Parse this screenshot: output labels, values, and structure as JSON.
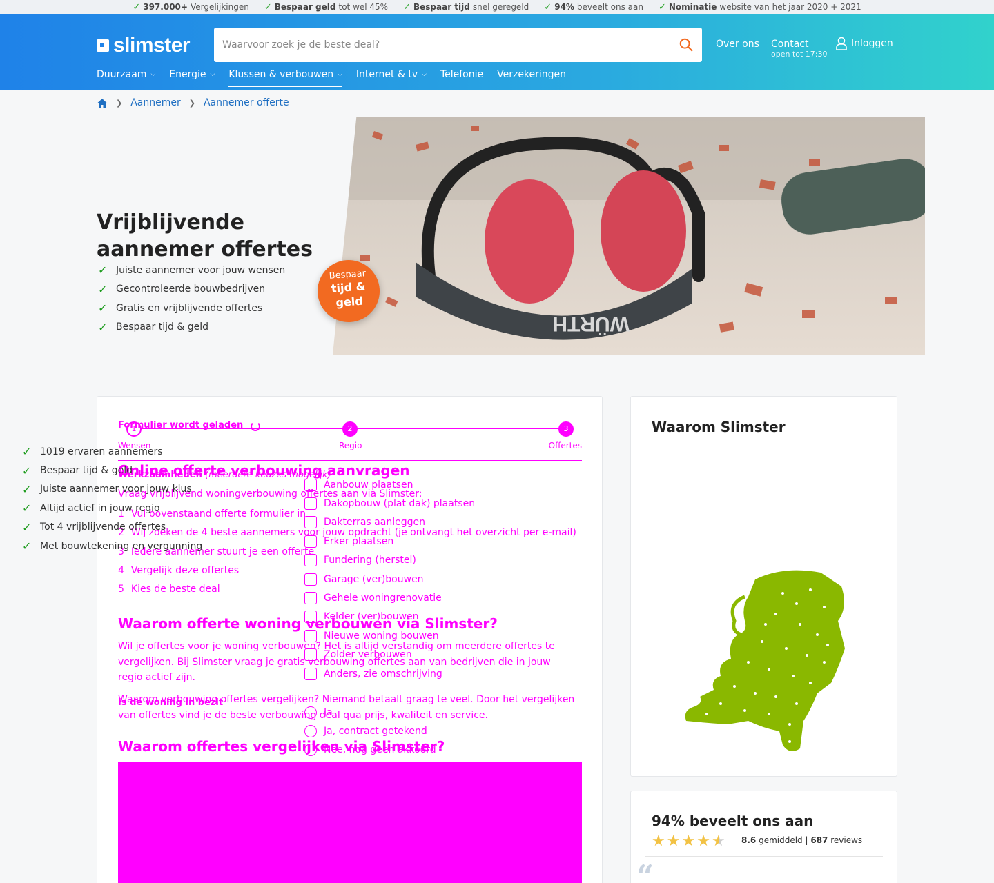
{
  "usp_bar": [
    {
      "bold": "397.000+",
      "text": " Vergelijkingen"
    },
    {
      "bold": "Bespaar geld",
      "text": " tot wel 45%"
    },
    {
      "bold": "Bespaar tijd",
      "text": " snel geregeld"
    },
    {
      "bold": "94%",
      "text": " beveelt ons aan"
    },
    {
      "bold": "Nominatie",
      "text": " website van het jaar 2020 + 2021"
    }
  ],
  "header": {
    "logo": "slimster",
    "search_placeholder": "Waarvoor zoek je de beste deal?",
    "over_ons": "Over ons",
    "contact": "Contact",
    "contact_hours": "open tot 17:30",
    "login": "Inloggen",
    "nav": [
      {
        "label": "Duurzaam",
        "dropdown": true
      },
      {
        "label": "Energie",
        "dropdown": true
      },
      {
        "label": "Klussen & verbouwen",
        "dropdown": true,
        "active": true
      },
      {
        "label": "Internet & tv",
        "dropdown": true
      },
      {
        "label": "Telefonie",
        "dropdown": false
      },
      {
        "label": "Verzekeringen",
        "dropdown": false
      }
    ]
  },
  "breadcrumb": [
    "Aannemer",
    "Aannemer offerte"
  ],
  "hero": {
    "title": "Vrijblijvende aannemer offertes",
    "bullets": [
      "Juiste aannemer voor jouw wensen",
      "Gecontroleerde bouwbedrijven",
      "Gratis en vrijblijvende offertes",
      "Bespaar tijd & geld"
    ],
    "badge_top": "Bespaar",
    "badge_bottom": "tijd & geld"
  },
  "form": {
    "loading": "Formulier wordt geladen",
    "steps": [
      "Wensen",
      "Regio",
      "Offertes"
    ],
    "step_numbers": [
      "1",
      "2",
      "3"
    ],
    "field_werkzaamheden": "Werkzaamheden",
    "field_werkzaamheden_hint": " (meerdere keuzes mogelijk)",
    "options": [
      "Aanbouw plaatsen",
      "Dakopbouw (plat dak) plaatsen",
      "Dakterras aanleggen",
      "Erker plaatsen",
      "Fundering (herstel)",
      "Garage (ver)bouwen",
      "Gehele woningrenovatie",
      "Kelder (ver)bouwen",
      "Nieuwe woning bouwen",
      "Zolder verbouwen",
      "Anders, zie omschrijving"
    ],
    "field_woning": "Is de woning in bezit",
    "woning_options": [
      "Ja",
      "Ja, contract getekend",
      "Nee, nog geen akkoord"
    ]
  },
  "article": {
    "h1": "Online offerte verbouwing aanvragen",
    "intro": "Vraag vrijblijvend woningverbouwing offertes aan via Slimster:",
    "steps": [
      "Vul bovenstaand offerte formulier in",
      "Wij zoeken de 4 beste aannemers voor jouw opdracht (je ontvangt het overzicht per e-mail)",
      "Iedere aannemer stuurt je een offerte",
      "Vergelijk deze offertes",
      "Kies de beste deal"
    ],
    "h2": "Waarom offerte woning verbouwen via Slimster?",
    "p1": "Wil je offertes voor je woning verbouwen? Het is altijd verstandig om meerdere offertes te vergelijken. Bij Slimster vraag je gratis verbouwing offertes aan van bedrijven die in jouw regio actief zijn.",
    "p2": "Waarom verbouwing offertes vergelijken? Niemand betaalt graag te veel. Door het vergelijken van offertes vind je de beste verbouwing deal qua prijs, kwaliteit en service.",
    "h3": "Waarom offertes vergelijken via Slimster?"
  },
  "why": {
    "title": "Waarom Slimster",
    "bullets": [
      "1019 ervaren aannemers",
      "Bespaar tijd & geld",
      "Juiste aannemer voor jouw klus",
      "Altijd actief in jouw regio",
      "Tot 4 vrijblijvende offertes",
      "Met bouwtekening en vergunning"
    ]
  },
  "reviews": {
    "title": "94% beveelt ons aan",
    "stars": 4.5,
    "score": "8.6",
    "score_label": " gemiddeld | ",
    "count": "687",
    "count_label": " reviews"
  },
  "colors": {
    "accent": "#1f82e8",
    "teal": "#31d2cc",
    "orange": "#f26a21",
    "check": "#1e9c1e",
    "map": "#8ab800"
  }
}
